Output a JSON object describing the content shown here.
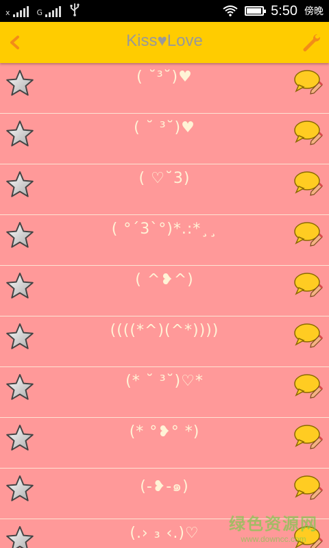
{
  "status_bar": {
    "sim1_label": "x",
    "sim2_label": "G",
    "time": "5:50",
    "period": "傍晚",
    "icons": [
      "signal-icon",
      "signal-icon",
      "usb-icon",
      "wifi-icon",
      "battery-icon"
    ],
    "battery_level": 0.95
  },
  "header": {
    "title_left": "Kiss",
    "title_heart": "♥",
    "title_right": "Love",
    "back_icon": "back-arrow-icon",
    "settings_icon": "wrench-icon",
    "accent_color": "#ffcc00",
    "title_color": "#999999"
  },
  "list": {
    "background_color": "#ff9999",
    "star_icon": "star-icon",
    "chat_icon": "chat-bubble-pencil-icon",
    "items": [
      {
        "text": "( ˘³˘)♥"
      },
      {
        "text": "( ˘ ³˘)♥"
      },
      {
        "text": "( ♡˘3)"
      },
      {
        "text": "( °´3`°)*.:*¸¸"
      },
      {
        "text": "( ^❥^)"
      },
      {
        "text": "((((*^)(^*))))"
      },
      {
        "text": "(* ˘ ³˘)♡*"
      },
      {
        "text": "(* °❥° *)"
      },
      {
        "text": "(-❥-๑)"
      },
      {
        "text": "(.› ₃ ‹.)♡"
      }
    ]
  },
  "watermark": {
    "cn": "绿色资源网",
    "url": "www.downcc.com"
  }
}
